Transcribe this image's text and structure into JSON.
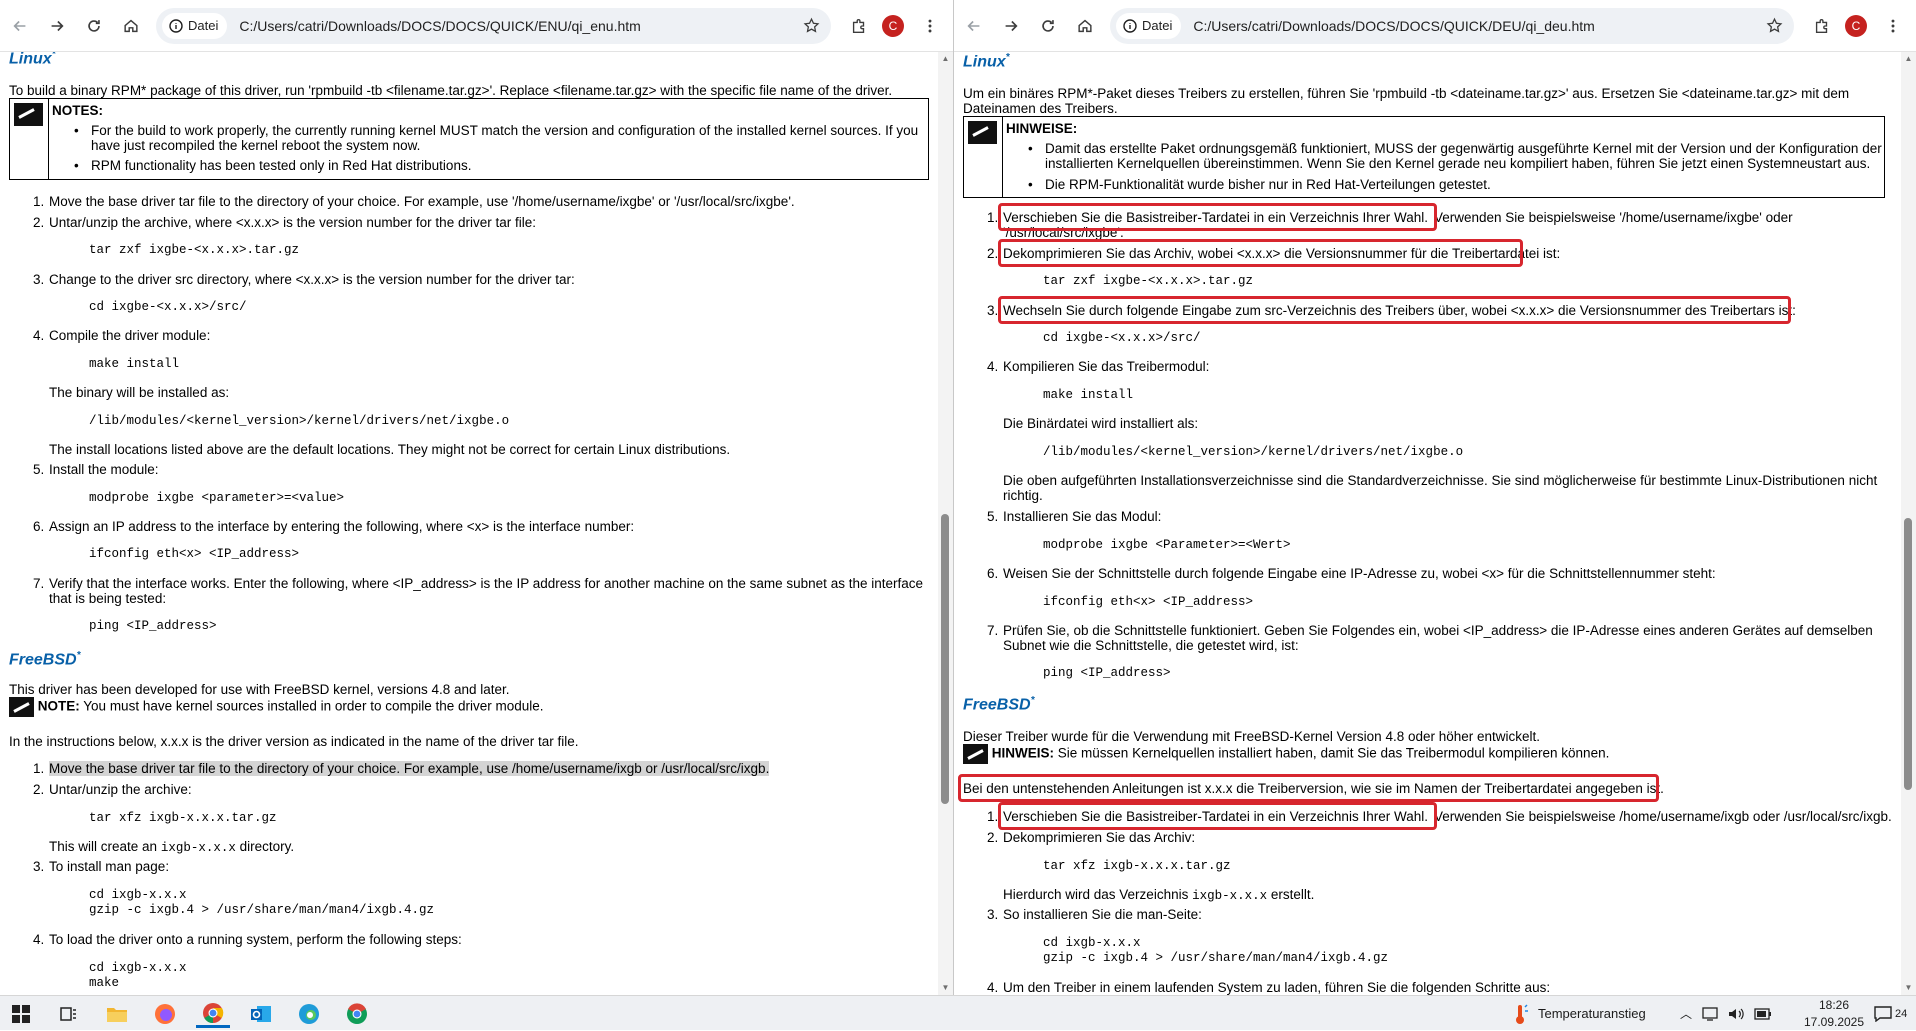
{
  "left": {
    "url_chip": "Datei",
    "url": "C:/Users/catri/Downloads/DOCS/DOCS/QUICK/ENU/qi_enu.htm",
    "avatar": "C",
    "linux_heading": "Linux",
    "sup": "*",
    "rpm_intro": "To build a binary RPM* package of this driver, run 'rpmbuild -tb <filename.tar.gz>'. Replace <filename.tar.gz> with the specific file name of the driver.",
    "notes_title": "NOTES:",
    "note1": "For the build to work properly, the currently running kernel MUST match the version and configuration of the installed kernel sources. If you",
    "note1b": "have just recompiled the kernel reboot the system now.",
    "note2": "RPM functionality has been tested only in Red Hat distributions.",
    "n1": "1.",
    "n2": "2.",
    "n3": "3.",
    "n4": "4.",
    "n5": "5.",
    "n6": "6.",
    "n7": "7.",
    "s1": "Move the base driver tar file to the directory of your choice. For example, use '/home/username/ixgbe' or '/usr/local/src/ixgbe'.",
    "s2": "Untar/unzip the archive, where <x.x.x> is the version number for the driver tar file:",
    "c2": "tar zxf ixgbe-<x.x.x>.tar.gz",
    "s3": "Change to the driver src directory, where <x.x.x> is the version number for the driver tar:",
    "c3": "cd ixgbe-<x.x.x>/src/",
    "s4": "Compile the driver module:",
    "c4": "make install",
    "s4b": "The binary will be installed as:",
    "c4b": "/lib/modules/<kernel_version>/kernel/drivers/net/ixgbe.o",
    "s4c": "The install locations listed above are the default locations. They might not be correct for certain Linux distributions.",
    "s5": "Install the module:",
    "c5": "modprobe ixgbe <parameter>=<value>",
    "s6": "Assign an IP address to the interface by entering the following, where <x> is the interface number:",
    "c6": "ifconfig eth<x> <IP_address>",
    "s7": "Verify that the interface works. Enter the following, where <IP_address> is the IP address for another machine on the same subnet as the interface",
    "s7b": "that is being tested:",
    "c7": "ping <IP_address>",
    "freebsd_heading": "FreeBSD",
    "fb_intro": "This driver has been developed for use with FreeBSD kernel, versions 4.8 and later.",
    "fb_note_label": "NOTE:",
    "fb_note": "You must have kernel sources installed in order to compile the driver module.",
    "fb_version": "In the instructions below, x.x.x is the driver version as indicated in the name of the driver tar file.",
    "f1": "Move the base driver tar file to the directory of your choice. For example, use /home/username/ixgb or /usr/local/src/ixgb.",
    "f2": "Untar/unzip the archive:",
    "fc2": "tar xfz ixgb-x.x.x.tar.gz",
    "f2b_pre": "This will create an",
    "f2b_code": "ixgb-x.x.x",
    "f2b_post": "directory.",
    "f3": "To install man page:",
    "fc3a": "cd ixgb-x.x.x",
    "fc3b": "gzip -c ixgb.4 > /usr/share/man/man4/ixgb.4.gz",
    "f4": "To load the driver onto a running system, perform the following steps:",
    "fc4a": "cd ixgb-x.x.x",
    "fc4b": "make"
  },
  "right": {
    "url_chip": "Datei",
    "url": "C:/Users/catri/Downloads/DOCS/DOCS/QUICK/DEU/qi_deu.htm",
    "avatar": "C",
    "linux_heading": "Linux",
    "sup": "*",
    "rpm_intro": "Um ein binäres RPM*-Paket dieses Treibers zu erstellen, führen Sie 'rpmbuild -tb <dateiname.tar.gz>' aus. Ersetzen Sie <dateiname.tar.gz> mit dem",
    "rpm_intro_b": "Dateinamen des Treibers.",
    "notes_title": "HINWEISE:",
    "note1": "Damit das erstellte Paket ordnungsgemäß funktioniert, MUSS der gegenwärtig ausgeführte Kernel mit der Version und der Konfiguration der",
    "note1b": "installierten Kernelquellen übereinstimmen. Wenn Sie den Kernel gerade neu kompiliert haben, führen Sie jetzt einen Systemneustart aus.",
    "note2": "Die RPM-Funktionalität wurde bisher nur in Red Hat-Verteilungen getestet.",
    "n1": "1.",
    "n2": "2.",
    "n3": "3.",
    "n4": "4.",
    "n5": "5.",
    "n6": "6.",
    "n7": "7.",
    "s1": "Verschieben Sie die Basistreiber-Tardatei in ein Verzeichnis Ihrer Wahl.",
    "s1_rest": "Verwenden Sie beispielsweise '/home/username/ixgbe' oder",
    "s1b": "'/usr/local/src/ixgbe'.",
    "s2": "Dekomprimieren Sie das Archiv, wobei <x.x.x> die Versionsnummer für die Treibertardatei ist:",
    "c2": "tar zxf ixgbe-<x.x.x>.tar.gz",
    "s3": "Wechseln Sie durch folgende Eingabe zum src-Verzeichnis des Treibers über, wobei <x.x.x> die Versionsnummer des Treibertars ist:",
    "c3": "cd ixgbe-<x.x.x>/src/",
    "s4": "Kompilieren Sie das Treibermodul:",
    "c4": "make install",
    "s4b": "Die Binärdatei wird installiert als:",
    "c4b": "/lib/modules/<kernel_version>/kernel/drivers/net/ixgbe.o",
    "s4c": "Die oben aufgeführten Installationsverzeichnisse sind die Standardverzeichnisse. Sie sind möglicherweise für bestimmte Linux-Distributionen nicht",
    "s4c_b": "richtig.",
    "s5": "Installieren Sie das Modul:",
    "c5": "modprobe ixgbe <Parameter>=<Wert>",
    "s6": "Weisen Sie der Schnittstelle durch folgende Eingabe eine IP-Adresse zu, wobei <x> für die Schnittstellennummer steht:",
    "c6": "ifconfig eth<x> <IP_address>",
    "s7": "Prüfen Sie, ob die Schnittstelle funktioniert. Geben Sie Folgendes ein, wobei <IP_address> die IP-Adresse eines anderen Gerätes auf demselben",
    "s7b": "Subnet wie die Schnittstelle, die getestet wird, ist:",
    "c7": "ping <IP_address>",
    "freebsd_heading": "FreeBSD",
    "fb_intro": "Dieser Treiber wurde für die Verwendung mit FreeBSD-Kernel Version 4.8 oder höher entwickelt.",
    "fb_note_label": "HINWEIS:",
    "fb_note": "Sie müssen Kernelquellen installiert haben, damit Sie das Treibermodul kompilieren können.",
    "fb_version": "Bei den untenstehenden Anleitungen ist x.x.x die Treiberversion, wie sie im Namen der Treibertardatei angegeben ist.",
    "f1": "Verschieben Sie die Basistreiber-Tardatei in ein Verzeichnis Ihrer Wahl.",
    "f1_rest": "Verwenden Sie beispielsweise /home/username/ixgb oder /usr/local/src/ixgb.",
    "f2": "Dekomprimieren Sie das Archiv:",
    "fc2": "tar xfz ixgb-x.x.x.tar.gz",
    "f2b_pre": "Hierdurch wird das Verzeichnis",
    "f2b_code": "ixgb-x.x.x",
    "f2b_post": "erstellt.",
    "f3": "So installieren Sie die man-Seite:",
    "fc3a": "cd ixgb-x.x.x",
    "fc3b": "gzip -c ixgb.4 > /usr/share/man/man4/ixgb.4.gz",
    "f4": "Um den Treiber in einem laufenden System zu laden, führen Sie die folgenden Schritte aus:"
  },
  "taskbar": {
    "weather": "Temperaturanstieg",
    "time": "18:26",
    "date": "17.09.2025",
    "notif_count": "24"
  },
  "colors": {
    "link_heading": "#0860a8",
    "highlight_box": "#d7262e",
    "avatar": "#c5221f"
  }
}
